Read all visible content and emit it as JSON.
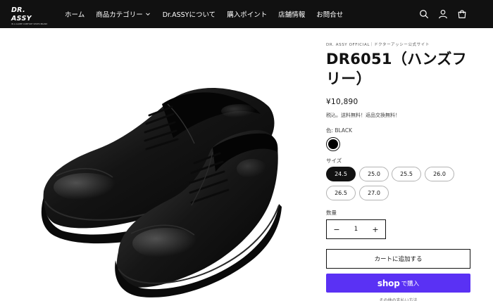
{
  "header": {
    "logo_text": "DR. ASSY",
    "logo_subtext": "IN A GLOBE COMFORT SHOES BRAND NEW",
    "nav": [
      {
        "label": "ホーム"
      },
      {
        "label": "商品カテゴリー"
      },
      {
        "label": "Dr.ASSYについて"
      },
      {
        "label": "購入ポイント"
      },
      {
        "label": "店舗情報"
      },
      {
        "label": "お問合せ"
      }
    ],
    "icons": [
      "search-icon",
      "account-icon",
      "cart-icon"
    ]
  },
  "product": {
    "image_alt": "black leather cap-toe oxford shoes",
    "brand": "DR. ASSY OFFICIAL｜ドクターアッシー公式サイト",
    "title": "DR6051（ハンズフリー）",
    "price": "¥10,890",
    "tax_note": "税込。送料無料！返品交換無料！",
    "color_label": "色: BLACK",
    "color_value": "#000000",
    "size_label": "サイズ",
    "sizes": [
      {
        "label": "24.5",
        "selected": true
      },
      {
        "label": "25.0",
        "selected": false
      },
      {
        "label": "25.5",
        "selected": false
      },
      {
        "label": "26.0",
        "selected": false
      },
      {
        "label": "26.5",
        "selected": false
      },
      {
        "label": "27.0",
        "selected": false
      }
    ],
    "quantity_label": "数量",
    "quantity": {
      "minus": "−",
      "value": "1",
      "plus": "+"
    },
    "add_to_cart": "カートに追加する",
    "shop_pay": {
      "logo": "shop",
      "label": "で購入"
    },
    "more_payment": "その他の支払い方法"
  },
  "colors": {
    "header_bg": "#111111",
    "accent": "#5a31f4",
    "text": "#121212"
  }
}
